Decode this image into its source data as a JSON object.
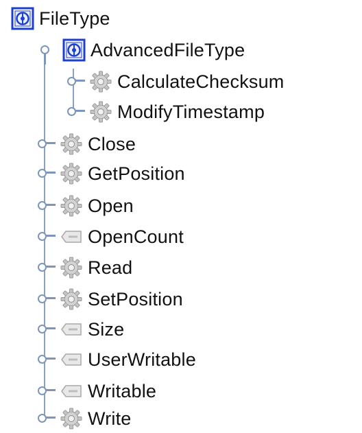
{
  "tree": {
    "root": {
      "label": "FileType",
      "icon": "interface-type-icon"
    },
    "advanced": {
      "label": "AdvancedFileType",
      "icon": "interface-type-icon"
    },
    "advanced_children": [
      {
        "label": "CalculateChecksum",
        "icon": "gear-method-icon"
      },
      {
        "label": "ModifyTimestamp",
        "icon": "gear-method-icon"
      }
    ],
    "members": [
      {
        "label": "Close",
        "icon": "gear-method-icon"
      },
      {
        "label": "GetPosition",
        "icon": "gear-method-icon"
      },
      {
        "label": "Open",
        "icon": "gear-method-icon"
      },
      {
        "label": "OpenCount",
        "icon": "tag-attribute-icon"
      },
      {
        "label": "Read",
        "icon": "gear-method-icon"
      },
      {
        "label": "SetPosition",
        "icon": "gear-method-icon"
      },
      {
        "label": "Size",
        "icon": "tag-attribute-icon"
      },
      {
        "label": "UserWritable",
        "icon": "tag-attribute-icon"
      },
      {
        "label": "Writable",
        "icon": "tag-attribute-icon"
      },
      {
        "label": "Write",
        "icon": "gear-method-icon"
      }
    ]
  },
  "colors": {
    "connector": "#7d95bb",
    "interface_border": "#1d3fd0",
    "gear": "#bcbcbc",
    "tag": "#c9c9c9"
  }
}
